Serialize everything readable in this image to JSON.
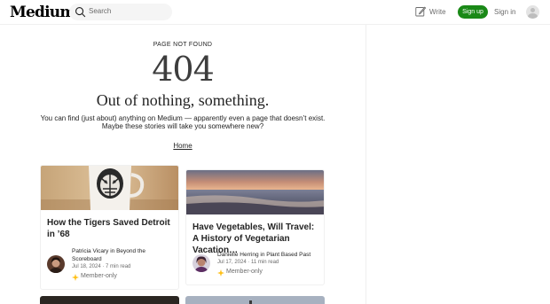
{
  "header": {
    "logo": "Medium",
    "search_placeholder": "Search",
    "write_label": "Write",
    "signup_label": "Sign up",
    "signin_label": "Sign in"
  },
  "notfound": {
    "eyebrow": "PAGE NOT FOUND",
    "code": "404",
    "tagline": "Out of nothing, something.",
    "description_line1": "You can find (just about) anything on Medium — apparently even a page that doesn’t exist.",
    "description_line2": "Maybe these stories will take you somewhere new?",
    "home_link": "Home"
  },
  "stories": [
    {
      "title": "How the Tigers Saved Detroit in ’68",
      "author": "Patricia Vicary in Beyond the Scoreboard",
      "meta": "Jul 18, 2024 · 7 min read",
      "badge": "Member-only"
    },
    {
      "title": "Have Vegetables, Will Travel: A History of Vegetarian Vacation…",
      "author": "Danielle Herring in Plant Based Past",
      "meta": "Jul 17, 2024 · 11 min read",
      "badge": "Member-only"
    }
  ],
  "colors": {
    "brand_green": "#1a8917",
    "member_star": "#ffc017",
    "text_primary": "#242424",
    "text_secondary": "#6b6b6b"
  },
  "icons": [
    "search-icon",
    "write-icon",
    "user-avatar-icon",
    "member-star-icon"
  ]
}
